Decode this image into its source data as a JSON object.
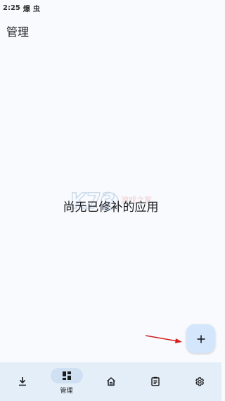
{
  "status_bar": {
    "time": "2:25",
    "icon_1": "爆",
    "icon_2": "虫"
  },
  "header": {
    "title": "管理"
  },
  "main": {
    "empty_message": "尚无已修补的应用"
  },
  "fab": {
    "label": "+",
    "icon": "plus-icon"
  },
  "bottom_nav": {
    "items": [
      {
        "icon": "download-icon",
        "label": ""
      },
      {
        "icon": "dashboard-icon",
        "label": "管理",
        "active": true
      },
      {
        "icon": "home-icon",
        "label": ""
      },
      {
        "icon": "clipboard-icon",
        "label": ""
      },
      {
        "icon": "gear-icon",
        "label": ""
      }
    ]
  },
  "colors": {
    "background": "#f8fafe",
    "nav_background": "#e4eef8",
    "nav_active_pill": "#cfe0f2",
    "fab_background": "#d4e6fb",
    "annotation_arrow": "#d32020",
    "text": "#1a1c1e"
  }
}
